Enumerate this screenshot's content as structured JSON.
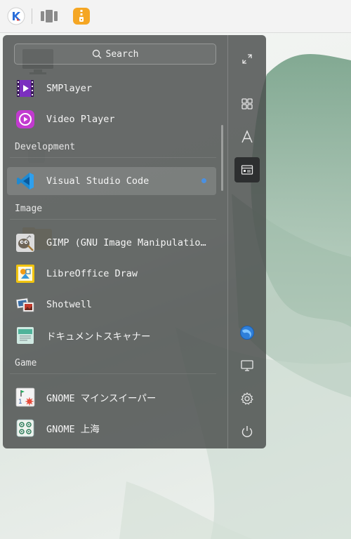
{
  "taskbar": {
    "items": [
      {
        "name": "start-menu-icon"
      },
      {
        "name": "multitask-view-icon"
      },
      {
        "name": "archive-manager-icon"
      }
    ]
  },
  "search": {
    "placeholder": "Search"
  },
  "apps": {
    "items": [
      {
        "label": "SMPlayer"
      },
      {
        "label": "Video Player"
      },
      {
        "label": "Visual Studio Code",
        "new": true
      },
      {
        "label": "GIMP (GNU Image Manipulation …"
      },
      {
        "label": "LibreOffice Draw"
      },
      {
        "label": "Shotwell"
      },
      {
        "label": "ドキュメントスキャナー"
      },
      {
        "label": "GNOME マインスイーパー"
      },
      {
        "label": "GNOME 上海"
      }
    ],
    "categories": [
      "Development",
      "Image",
      "Game"
    ]
  },
  "sidebar": {
    "buttons": [
      {
        "name": "fullscreen-icon"
      },
      {
        "name": "grid-view-icon"
      },
      {
        "name": "letter-index-icon"
      },
      {
        "name": "category-view-icon",
        "selected": true
      },
      {
        "name": "browser-icon"
      },
      {
        "name": "display-icon"
      },
      {
        "name": "settings-icon"
      },
      {
        "name": "power-icon"
      }
    ]
  },
  "colors": {
    "accent": "#4a90e2",
    "launcher_bg": "#484c4a"
  }
}
